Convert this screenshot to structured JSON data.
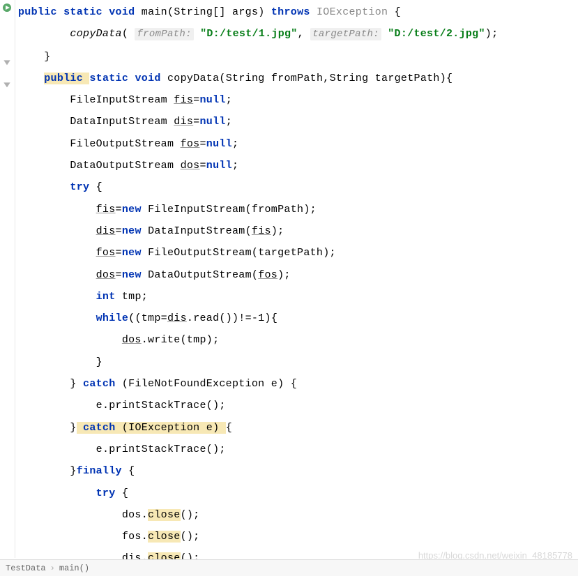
{
  "code": {
    "l1_kw1": "public",
    "l1_kw2": "static",
    "l1_kw3": "void",
    "l1_method": "main",
    "l1_paramtype": "String[]",
    "l1_paramname": "args",
    "l1_kw4": "throws",
    "l1_exc": "IOException",
    "l2_method": "copyData",
    "l2_hint1": "fromPath:",
    "l2_str1": "\"D:/test/1.jpg\"",
    "l2_hint2": "targetPath:",
    "l2_str2": "\"D:/test/2.jpg\"",
    "l4_kw1": "public",
    "l4_kw2": "static",
    "l4_kw3": "void",
    "l4_method": "copyData",
    "l4_p1type": "String",
    "l4_p1name": "fromPath",
    "l4_p2type": "String",
    "l4_p2name": "targetPath",
    "l5_type": "FileInputStream",
    "l5_var": "fis",
    "l5_null": "null",
    "l6_type": "DataInputStream",
    "l6_var": "dis",
    "l6_null": "null",
    "l7_type": "FileOutputStream",
    "l7_var": "fos",
    "l7_null": "null",
    "l8_type": "DataOutputStream",
    "l8_var": "dos",
    "l8_null": "null",
    "l9_try": "try",
    "l10_var": "fis",
    "l10_new": "new",
    "l10_type": "FileInputStream",
    "l10_arg": "fromPath",
    "l11_var": "dis",
    "l11_new": "new",
    "l11_type": "DataInputStream",
    "l11_arg": "fis",
    "l12_var": "fos",
    "l12_new": "new",
    "l12_type": "FileOutputStream",
    "l12_arg": "targetPath",
    "l13_var": "dos",
    "l13_new": "new",
    "l13_type": "DataOutputStream",
    "l13_arg": "fos",
    "l14_kw": "int",
    "l14_var": "tmp",
    "l15_kw": "while",
    "l15_var1": "tmp",
    "l15_var2": "dis",
    "l15_method": "read",
    "l15_neg1": "-1",
    "l16_var": "dos",
    "l16_method": "write",
    "l16_arg": "tmp",
    "l18_catch": "catch",
    "l18_type": "FileNotFoundException",
    "l18_var": "e",
    "l19_var": "e",
    "l19_method": "printStackTrace",
    "l20_catch": "catch",
    "l20_type": "IOException",
    "l20_var": "e",
    "l21_var": "e",
    "l21_method": "printStackTrace",
    "l22_kw": "finally",
    "l23_try": "try",
    "l24_var": "dos",
    "l24_method": "close",
    "l25_var": "fos",
    "l25_method": "close",
    "l26_var": "dis",
    "l26_method": "close"
  },
  "breadcrumb": {
    "class": "TestData",
    "method": "main()"
  },
  "watermark": "https://blog.csdn.net/weixin_48185778"
}
